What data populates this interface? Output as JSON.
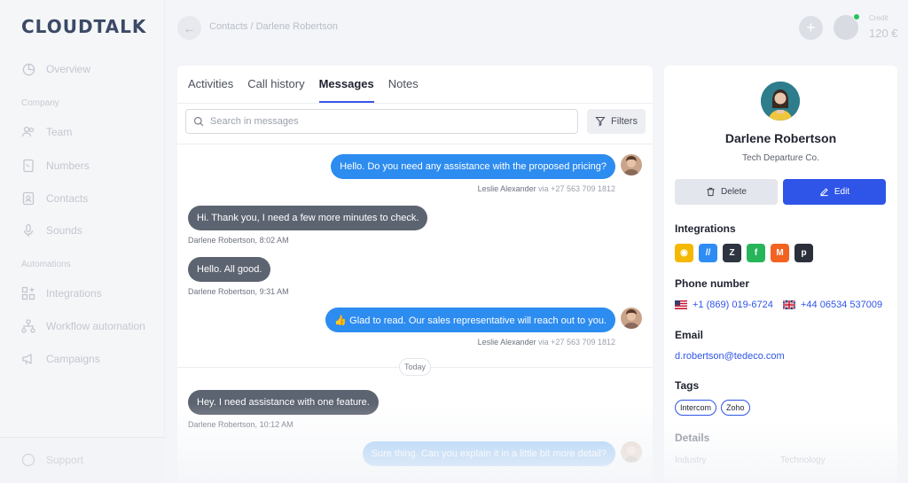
{
  "app": {
    "logo": "CLOUDTALK"
  },
  "sidebar": {
    "overview": "Overview",
    "company_section": "Company",
    "company_items": [
      {
        "label": "Team",
        "icon": "users-icon"
      },
      {
        "label": "Numbers",
        "icon": "phone-book-icon"
      },
      {
        "label": "Contacts",
        "icon": "contact-card-icon"
      },
      {
        "label": "Sounds",
        "icon": "microphone-icon"
      }
    ],
    "automations_section": "Automations",
    "automation_items": [
      {
        "label": "Integrations",
        "icon": "puzzle-icon"
      },
      {
        "label": "Workflow automation",
        "icon": "workflow-icon"
      },
      {
        "label": "Campaigns",
        "icon": "megaphone-icon"
      }
    ],
    "bottom_label": "Support"
  },
  "header": {
    "breadcrumb": "Contacts / Darlene Robertson",
    "credit_label": "Credit",
    "credit_value": "120 €"
  },
  "tabs": [
    {
      "label": "Activities",
      "active": false
    },
    {
      "label": "Call history",
      "active": false
    },
    {
      "label": "Messages",
      "active": true
    },
    {
      "label": "Notes",
      "active": false
    }
  ],
  "search": {
    "placeholder": "Search in messages",
    "value": ""
  },
  "filters_label": "Filters",
  "messages": [
    {
      "text": "Hello. Do you need any assistance with the proposed pricing?",
      "author": "Leslie Alexander",
      "via": "via +27 563 709 1812"
    },
    {
      "text": "Hi. Thank you, I need a few more minutes to check.",
      "author": "Darlene Robertson",
      "time": "8:02 AM"
    },
    {
      "text": "Hello. All good.",
      "author": "Darlene Robertson",
      "time": "9:31 AM"
    },
    {
      "text": "👍 Glad to read. Our sales representative will reach out to you.",
      "author": "Leslie Alexander",
      "via": "via +27 563 709 1812"
    },
    {
      "text": "Hey. I need assistance with one feature.",
      "author": "Darlene Robertson",
      "time": "10:12 AM"
    },
    {
      "text": "Sure thing. Can you explain it in a little bit more detail?"
    }
  ],
  "separator": "Today",
  "contact": {
    "name": "Darlene Robertson",
    "company": "Tech Departure Co.",
    "delete_label": "Delete",
    "edit_label": "Edit",
    "integrations_title": "Integrations",
    "integrations": [
      {
        "name": "chat-integration-icon",
        "color": "#f5b800",
        "glyph": "◉"
      },
      {
        "name": "slash-integration-icon",
        "color": "#2f8cf5",
        "glyph": "//"
      },
      {
        "name": "zendesk-icon",
        "color": "#2e3440",
        "glyph": "Z"
      },
      {
        "name": "freshdesk-icon",
        "color": "#27b55a",
        "glyph": "f"
      },
      {
        "name": "magento-icon",
        "color": "#f26322",
        "glyph": "M"
      },
      {
        "name": "pipedrive-icon",
        "color": "#2b2f3a",
        "glyph": "p"
      }
    ],
    "phone_title": "Phone number",
    "phones": [
      "+1 (869) 019-6724",
      "+44 06534 537009"
    ],
    "email_title": "Email",
    "email": "d.robertson@tedeco.com",
    "tags_title": "Tags",
    "tags": [
      "Intercom",
      "Zoho"
    ],
    "details_title": "Details",
    "details": {
      "label": "Industry",
      "value": "Technology"
    }
  },
  "colors": {
    "accent": "#2f55e8",
    "outgoing": "#2d8cf0",
    "incoming": "#5d6471"
  }
}
